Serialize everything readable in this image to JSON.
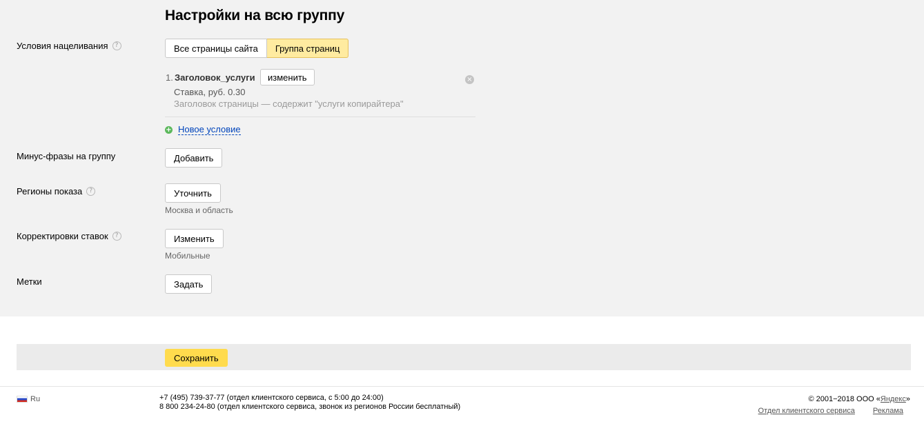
{
  "title": "Настройки на всю группу",
  "targeting": {
    "label": "Условия нацеливания",
    "help": "?",
    "segments": [
      "Все страницы сайта",
      "Группа страниц"
    ],
    "active_segment": "Группа страниц",
    "condition": {
      "number": "1.",
      "name": "Заголовок_услуги",
      "edit_label": "изменить",
      "bid": "Ставка, руб. 0.30",
      "description": "Заголовок страницы — содержит \"услуги копирайтера\"",
      "remove_icon": "×"
    },
    "new_condition_label": "Новое условие"
  },
  "negative": {
    "label": "Минус-фразы на группу",
    "button": "Добавить"
  },
  "regions": {
    "label": "Регионы показа",
    "help": "?",
    "button": "Уточнить",
    "value": "Москва и область"
  },
  "bid_adjust": {
    "label": "Корректировки ставок",
    "help": "?",
    "button": "Изменить",
    "value": "Мобильные"
  },
  "tags": {
    "label": "Метки",
    "button": "Задать"
  },
  "save": {
    "button": "Сохранить"
  },
  "footer": {
    "lang": "Ru",
    "phone1": "+7 (495) 739-37-77 (отдел клиентского сервиса, с 5:00 до 24:00)",
    "phone2": "8 800 234-24-80 (отдел клиентского сервиса, звонок из регионов России бесплатный)",
    "copyright_prefix": "© 2001−2018 ООО «",
    "copyright_link": "Яндекс",
    "copyright_suffix": "»",
    "links": [
      "Отдел клиентского сервиса",
      "Реклама"
    ]
  }
}
